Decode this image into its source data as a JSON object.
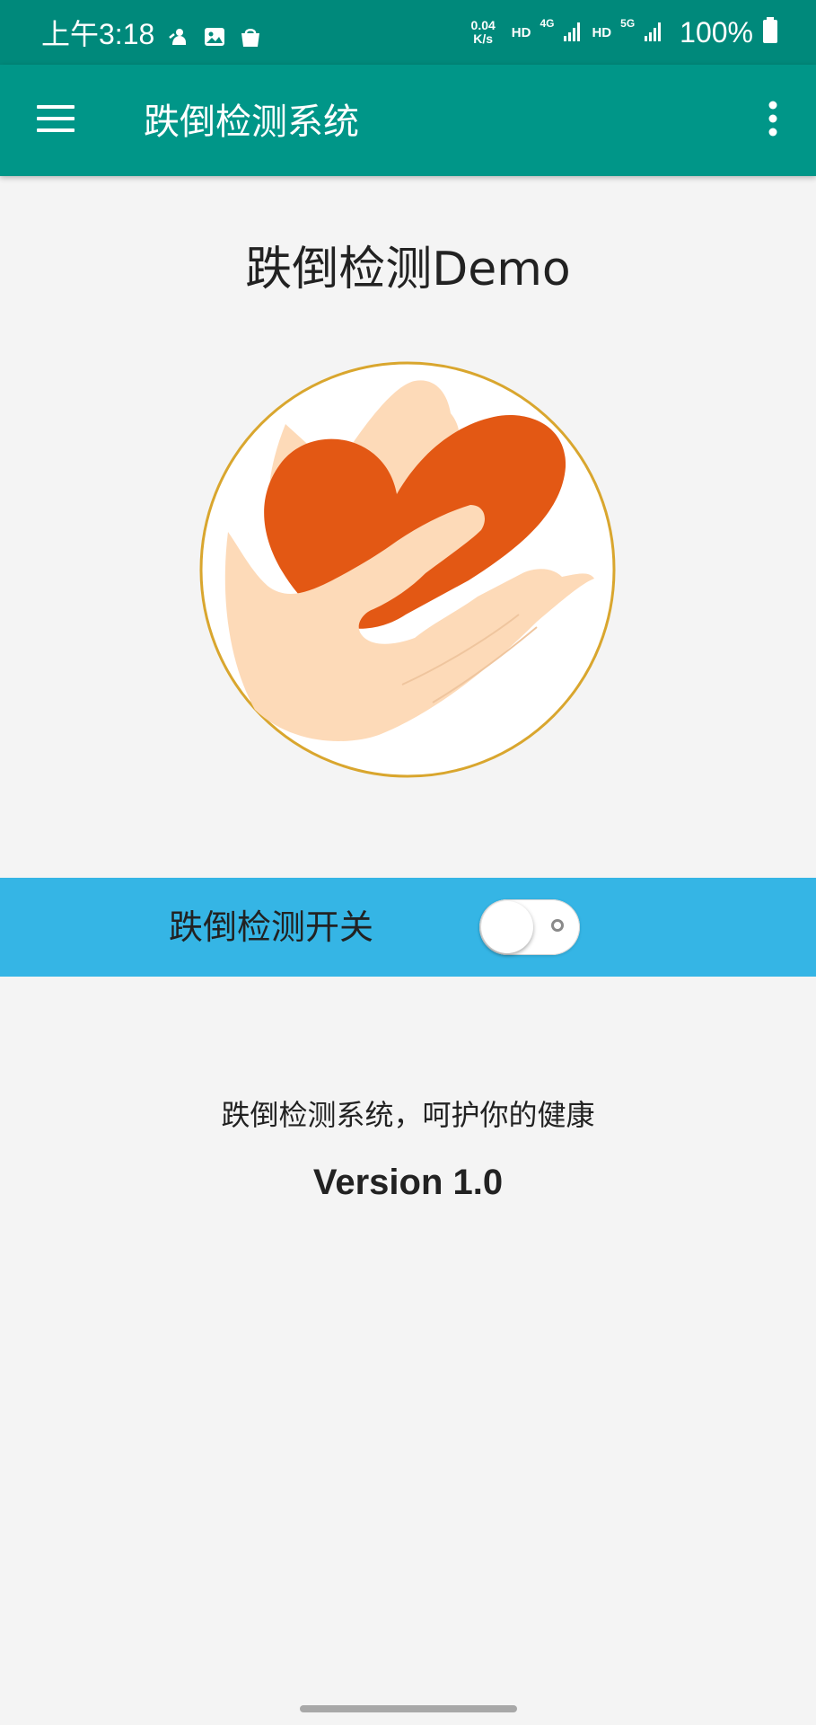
{
  "status_bar": {
    "time": "上午3:18",
    "net_speed_value": "0.04",
    "net_speed_unit": "K/s",
    "hd1": "HD",
    "net_type1": "4G",
    "hd2": "HD",
    "net_type2": "5G",
    "battery_percent": "100%",
    "left_icons": [
      "notification-app-icon",
      "gallery-icon",
      "shopping-bag-icon"
    ]
  },
  "app_bar": {
    "title": "跌倒检测系统",
    "menu_icon": "hamburger-menu-icon",
    "overflow_icon": "more-vert-icon"
  },
  "main": {
    "title": "跌倒检测Demo",
    "logo_icon": "heart-in-hand-icon",
    "toggle_label": "跌倒检测开关",
    "toggle_state": "off",
    "tagline": "跌倒检测系统，呵护你的健康",
    "version": "Version 1.0"
  },
  "colors": {
    "status_bar": "#00897b",
    "app_bar": "#009688",
    "toggle_banner": "#35b5e5",
    "heart": "#e35814",
    "hand": "#fddab8",
    "logo_ring": "#d9a62e",
    "background": "#f4f4f4"
  }
}
